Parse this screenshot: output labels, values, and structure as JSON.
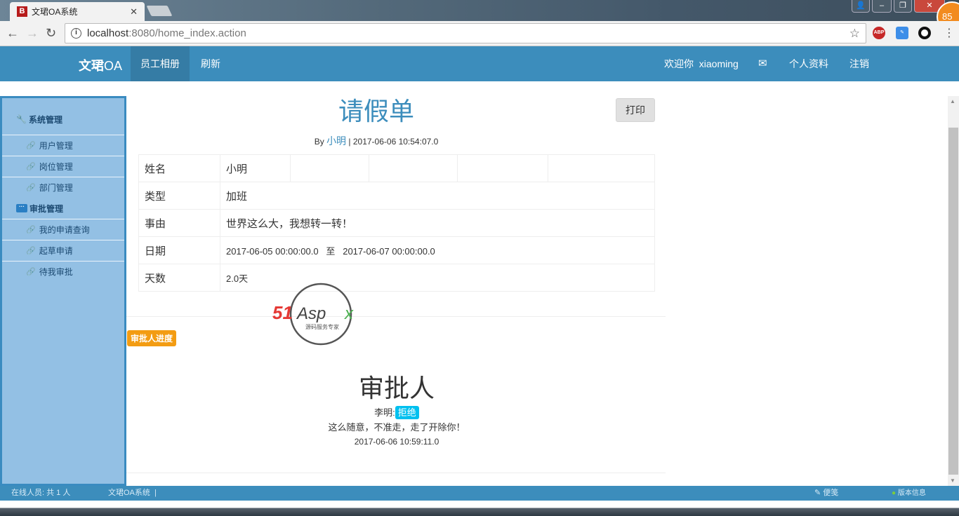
{
  "browser": {
    "tab_title": "文珺OA系统",
    "tab_favicon": "B",
    "url_host": "localhost",
    "url_rest": ":8080/home_index.action",
    "ext_badge": "85",
    "ext_abp": "ABP"
  },
  "nav": {
    "brand_bold": "文珺",
    "brand_rest": "OA",
    "items": [
      "员工相册",
      "刷新"
    ],
    "welcome": "欢迎你  xiaoming",
    "profile": "个人资料",
    "logout": "注销"
  },
  "sidebar": {
    "groups": [
      {
        "label": "系统管理",
        "items": [
          "用户管理",
          "岗位管理",
          "部门管理"
        ]
      },
      {
        "label": "审批管理",
        "items": [
          "我的申请查询",
          "起草申请",
          "待我审批"
        ]
      }
    ]
  },
  "form": {
    "title": "请假单",
    "print": "打印",
    "by": "By",
    "author": "小明",
    "created": "| 2017-06-06 10:54:07.0",
    "rows": [
      {
        "label": "姓名",
        "value": "小明"
      },
      {
        "label": "类型",
        "value": "加班"
      },
      {
        "label": "事由",
        "value": "世界这么大，我想转一转！"
      },
      {
        "label": "日期",
        "value": "2017-06-05 00:00:00.0   至   2017-06-07 00:00:00.0"
      },
      {
        "label": "天数",
        "value": "2.0天"
      }
    ]
  },
  "progress_label": "审批人进度",
  "watermark": {
    "brand": "51Aspx",
    "tagline": "源码服务专家"
  },
  "approval": {
    "heading": "审批人",
    "approver": "李明:",
    "status": "拒绝",
    "comment": "这么随意，不准走，走了开除你！",
    "time": "2017-06-06 10:59:11.0"
  },
  "footer": {
    "online": "在线人员: 共 1 人",
    "system": "文珺OA系统  |",
    "notes": "便笺",
    "version": "版本信息"
  },
  "colors": {
    "primary": "#3c8dbc",
    "sidebar": "#93c0e4",
    "warning": "#f39c12",
    "info": "#00c0ef"
  }
}
